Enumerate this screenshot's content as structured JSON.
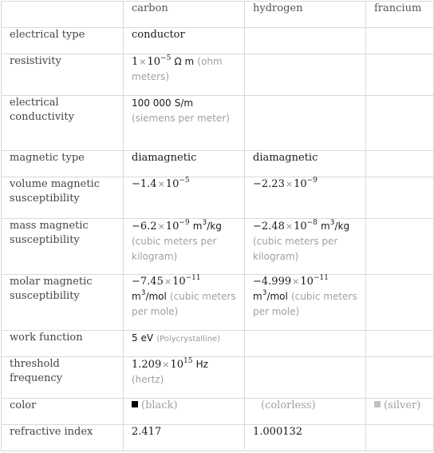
{
  "table": {
    "columns": [
      "",
      "carbon",
      "hydrogen",
      "francium"
    ],
    "rows": {
      "electrical_type": {
        "label": "electrical type",
        "carbon": "conductor",
        "hydrogen": "",
        "francium": ""
      },
      "resistivity": {
        "label": "resistivity",
        "carbon": {
          "mantissa": "1",
          "times": "×",
          "base": "10",
          "exponent": "−5",
          "unit": "Ω m",
          "unit_desc": "(ohm meters)"
        },
        "hydrogen": "",
        "francium": ""
      },
      "electrical_conductivity": {
        "label": "electrical conductivity",
        "carbon": {
          "value": "100 000",
          "unit": "S/m",
          "unit_desc": "(siemens per meter)"
        },
        "hydrogen": "",
        "francium": ""
      },
      "magnetic_type": {
        "label": "magnetic type",
        "carbon": "diamagnetic",
        "hydrogen": "diamagnetic",
        "francium": ""
      },
      "volume_magnetic_susceptibility": {
        "label": "volume magnetic susceptibility",
        "carbon": {
          "mantissa": "−1.4",
          "times": "×",
          "base": "10",
          "exponent": "−5"
        },
        "hydrogen": {
          "mantissa": "−2.23",
          "times": "×",
          "base": "10",
          "exponent": "−9"
        },
        "francium": ""
      },
      "mass_magnetic_susceptibility": {
        "label": "mass magnetic susceptibility",
        "carbon": {
          "mantissa": "−6.2",
          "times": "×",
          "base": "10",
          "exponent": "−9",
          "unit_base": "m",
          "unit_exp": "3",
          "unit_tail": "/kg",
          "unit_desc": "(cubic meters per kilogram)"
        },
        "hydrogen": {
          "mantissa": "−2.48",
          "times": "×",
          "base": "10",
          "exponent": "−8",
          "unit_base": "m",
          "unit_exp": "3",
          "unit_tail": "/kg",
          "unit_desc": "(cubic meters per kilogram)"
        },
        "francium": ""
      },
      "molar_magnetic_susceptibility": {
        "label": "molar magnetic susceptibility",
        "carbon": {
          "mantissa": "−7.45",
          "times": "×",
          "base": "10",
          "exponent": "−11",
          "unit_base": "m",
          "unit_exp": "3",
          "unit_tail": "/mol",
          "unit_desc": "(cubic meters per mole)"
        },
        "hydrogen": {
          "mantissa": "−4.999",
          "times": "×",
          "base": "10",
          "exponent": "−11",
          "unit_base": "m",
          "unit_exp": "3",
          "unit_tail": "/mol",
          "unit_desc": "(cubic meters per mole)"
        },
        "francium": ""
      },
      "work_function": {
        "label": "work function",
        "carbon": {
          "value": "5 eV",
          "note": "(Polycrystalline)"
        },
        "hydrogen": "",
        "francium": ""
      },
      "threshold_frequency": {
        "label": "threshold frequency",
        "carbon": {
          "mantissa": "1.209",
          "times": "×",
          "base": "10",
          "exponent": "15",
          "unit": "Hz",
          "unit_desc": "(hertz)"
        },
        "hydrogen": "",
        "francium": ""
      },
      "color": {
        "label": "color",
        "carbon": {
          "name": "(black)",
          "swatch": "#000000"
        },
        "hydrogen": {
          "name": "(colorless)"
        },
        "francium": {
          "name": "(silver)",
          "swatch": "#c0c0c0"
        }
      },
      "refractive_index": {
        "label": "refractive index",
        "carbon": "2.417",
        "hydrogen": "1.000132",
        "francium": ""
      }
    }
  }
}
